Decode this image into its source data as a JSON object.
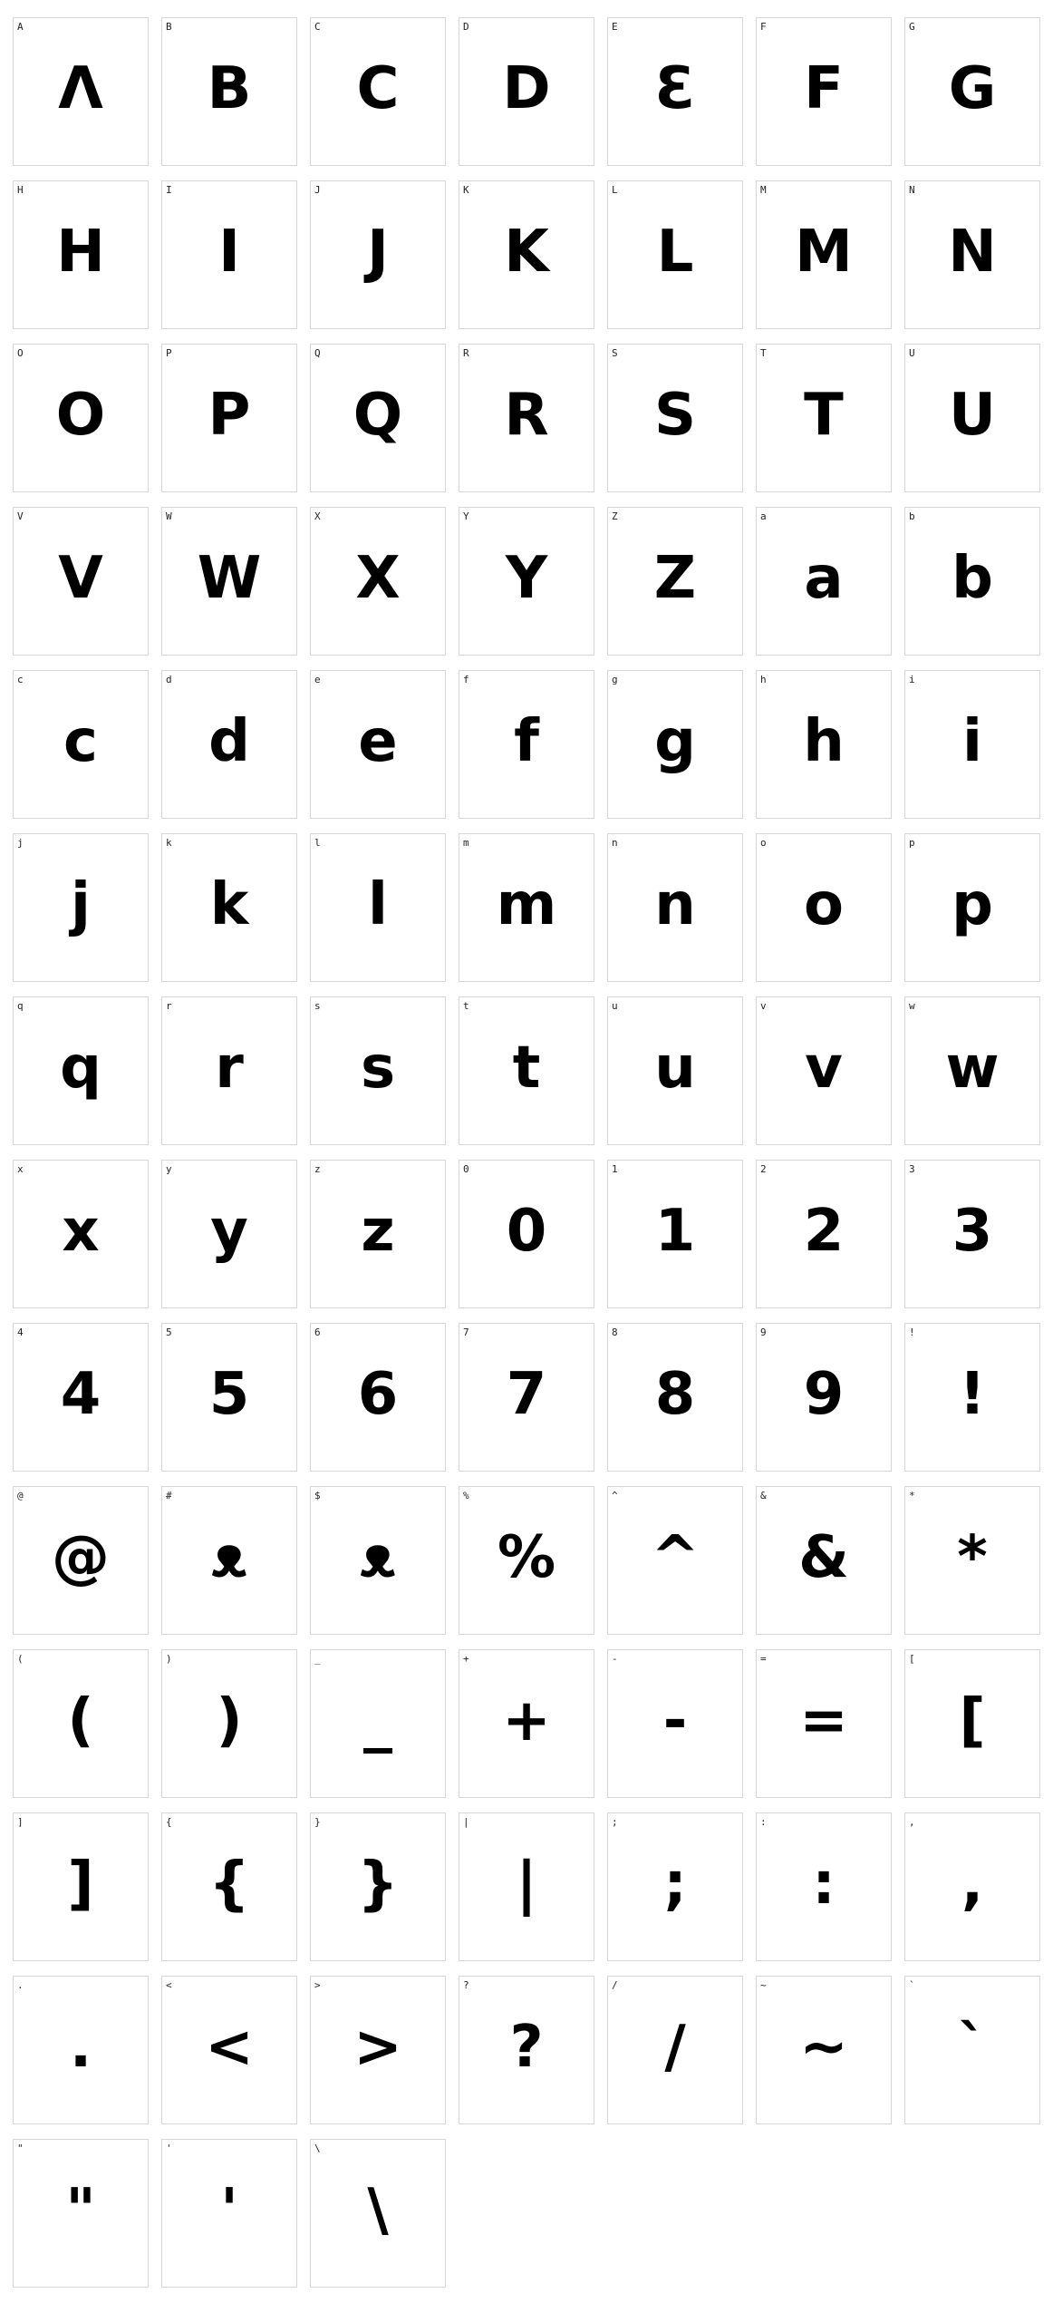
{
  "glyphs": [
    {
      "label": "A",
      "char": "Λ"
    },
    {
      "label": "B",
      "char": "B"
    },
    {
      "label": "C",
      "char": "C"
    },
    {
      "label": "D",
      "char": "D"
    },
    {
      "label": "E",
      "char": "Ɛ"
    },
    {
      "label": "F",
      "char": "F"
    },
    {
      "label": "G",
      "char": "G"
    },
    {
      "label": "H",
      "char": "H"
    },
    {
      "label": "I",
      "char": "I"
    },
    {
      "label": "J",
      "char": "J"
    },
    {
      "label": "K",
      "char": "K"
    },
    {
      "label": "L",
      "char": "L"
    },
    {
      "label": "M",
      "char": "M"
    },
    {
      "label": "N",
      "char": "N"
    },
    {
      "label": "O",
      "char": "O"
    },
    {
      "label": "P",
      "char": "P"
    },
    {
      "label": "Q",
      "char": "Q"
    },
    {
      "label": "R",
      "char": "R"
    },
    {
      "label": "S",
      "char": "S"
    },
    {
      "label": "T",
      "char": "T"
    },
    {
      "label": "U",
      "char": "U"
    },
    {
      "label": "V",
      "char": "V"
    },
    {
      "label": "W",
      "char": "W"
    },
    {
      "label": "X",
      "char": "X"
    },
    {
      "label": "Y",
      "char": "Y"
    },
    {
      "label": "Z",
      "char": "Z"
    },
    {
      "label": "a",
      "char": "a"
    },
    {
      "label": "b",
      "char": "b"
    },
    {
      "label": "c",
      "char": "c"
    },
    {
      "label": "d",
      "char": "d"
    },
    {
      "label": "e",
      "char": "e"
    },
    {
      "label": "f",
      "char": "f"
    },
    {
      "label": "g",
      "char": "g"
    },
    {
      "label": "h",
      "char": "h"
    },
    {
      "label": "i",
      "char": "i"
    },
    {
      "label": "j",
      "char": "j"
    },
    {
      "label": "k",
      "char": "k"
    },
    {
      "label": "l",
      "char": "l"
    },
    {
      "label": "m",
      "char": "m"
    },
    {
      "label": "n",
      "char": "n"
    },
    {
      "label": "o",
      "char": "o"
    },
    {
      "label": "p",
      "char": "p"
    },
    {
      "label": "q",
      "char": "q"
    },
    {
      "label": "r",
      "char": "r"
    },
    {
      "label": "s",
      "char": "s"
    },
    {
      "label": "t",
      "char": "t"
    },
    {
      "label": "u",
      "char": "u"
    },
    {
      "label": "v",
      "char": "v"
    },
    {
      "label": "w",
      "char": "w"
    },
    {
      "label": "x",
      "char": "x"
    },
    {
      "label": "y",
      "char": "y"
    },
    {
      "label": "z",
      "char": "z"
    },
    {
      "label": "0",
      "char": "0"
    },
    {
      "label": "1",
      "char": "1"
    },
    {
      "label": "2",
      "char": "2"
    },
    {
      "label": "3",
      "char": "3"
    },
    {
      "label": "4",
      "char": "4"
    },
    {
      "label": "5",
      "char": "5"
    },
    {
      "label": "6",
      "char": "6"
    },
    {
      "label": "7",
      "char": "7"
    },
    {
      "label": "8",
      "char": "8"
    },
    {
      "label": "9",
      "char": "9"
    },
    {
      "label": "!",
      "char": "!"
    },
    {
      "label": "@",
      "char": "@"
    },
    {
      "label": "#",
      "char": "ᴥ"
    },
    {
      "label": "$",
      "char": "ᴥ"
    },
    {
      "label": "%",
      "char": "%"
    },
    {
      "label": "^",
      "char": "^"
    },
    {
      "label": "&",
      "char": "&"
    },
    {
      "label": "*",
      "char": "*"
    },
    {
      "label": "(",
      "char": "("
    },
    {
      "label": ")",
      "char": ")"
    },
    {
      "label": "_",
      "char": "_"
    },
    {
      "label": "+",
      "char": "+"
    },
    {
      "label": "-",
      "char": "-"
    },
    {
      "label": "=",
      "char": "="
    },
    {
      "label": "[",
      "char": "["
    },
    {
      "label": "]",
      "char": "]"
    },
    {
      "label": "{",
      "char": "{"
    },
    {
      "label": "}",
      "char": "}"
    },
    {
      "label": "|",
      "char": "|"
    },
    {
      "label": ";",
      "char": ";"
    },
    {
      "label": ":",
      "char": ":"
    },
    {
      "label": ",",
      "char": ","
    },
    {
      "label": ".",
      "char": "."
    },
    {
      "label": "<",
      "char": "<"
    },
    {
      "label": ">",
      "char": ">"
    },
    {
      "label": "?",
      "char": "?"
    },
    {
      "label": "/",
      "char": "/"
    },
    {
      "label": "~",
      "char": "~"
    },
    {
      "label": "`",
      "char": "`"
    },
    {
      "label": "\"",
      "char": "\""
    },
    {
      "label": "'",
      "char": "'"
    },
    {
      "label": "\\",
      "char": "\\"
    }
  ]
}
